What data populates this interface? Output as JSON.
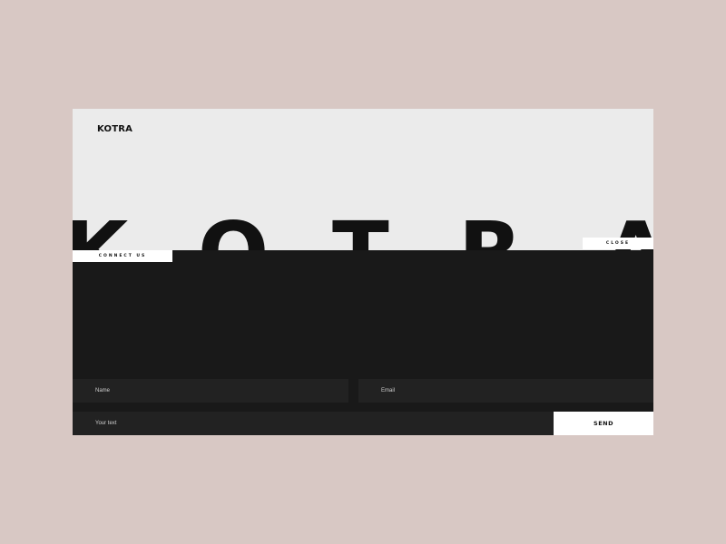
{
  "header": {
    "logo": "KOTRA"
  },
  "hero": {
    "letters": [
      "K",
      "O",
      "T",
      "R",
      "A"
    ]
  },
  "nav": {
    "connect_label": "CONNECT US",
    "close_label": "CLOSE"
  },
  "form": {
    "name_placeholder": "Name",
    "email_placeholder": "Email",
    "text_placeholder": "Your text",
    "send_label": "SEND"
  },
  "colors": {
    "page_background": "#d8c8c4",
    "frame_background": "#ebebeb",
    "panel_background": "#191919",
    "field_background": "#222222",
    "text_dark": "#111111",
    "button_background": "#ffffff"
  }
}
